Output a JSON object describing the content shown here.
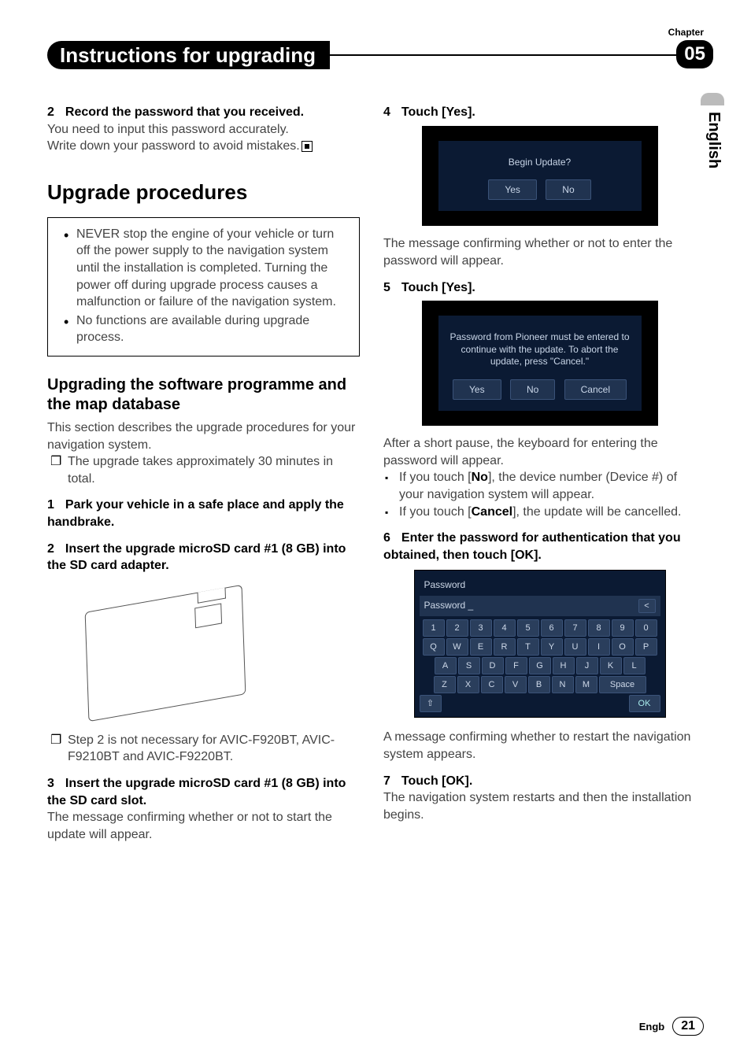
{
  "chapter": {
    "label": "Chapter",
    "number": "05"
  },
  "header": {
    "title": "Instructions for upgrading"
  },
  "side_tab": "English",
  "left": {
    "step2_pre": {
      "num": "2",
      "title": "Record the password that you received."
    },
    "step2_body1": "You need to input this password accurately.",
    "step2_body2": "Write down your password to avoid mistakes.",
    "section": "Upgrade procedures",
    "callout": [
      "NEVER stop the engine of your vehicle or turn off the power supply to the navigation system until the installation is completed. Turning the power off during upgrade process causes a malfunction or failure of the navigation system.",
      "No functions are available during upgrade process."
    ],
    "subheading": "Upgrading the software programme and the map database",
    "sub_body": "This section describes the upgrade procedures for your navigation system.",
    "sub_note": "The upgrade takes approximately 30 minutes in total.",
    "s1": {
      "num": "1",
      "title": "Park your vehicle in a safe place and apply the handbrake."
    },
    "s2": {
      "num": "2",
      "title": "Insert the upgrade microSD card #1 (8 GB) into the SD card adapter."
    },
    "s2_note": "Step 2 is not necessary for AVIC-F920BT, AVIC-F9210BT and AVIC-F9220BT.",
    "s3": {
      "num": "3",
      "title": "Insert the upgrade microSD card #1 (8 GB) into the SD card slot."
    },
    "s3_body": "The message confirming whether or not to start the update will appear."
  },
  "right": {
    "s4": {
      "num": "4",
      "title": "Touch [Yes]."
    },
    "screen1": {
      "msg": "Begin Update?",
      "yes": "Yes",
      "no": "No"
    },
    "s4_body": "The message confirming whether or not to enter the password will appear.",
    "s5": {
      "num": "5",
      "title": "Touch [Yes]."
    },
    "screen2": {
      "msg": "Password from Pioneer must be entered to continue with the update.  To abort the update, press \"Cancel.\"",
      "yes": "Yes",
      "no": "No",
      "cancel": "Cancel"
    },
    "s5_body": "After a short pause, the keyboard for entering the password will appear.",
    "s5_b1a": "If you touch [",
    "s5_b1b": "No",
    "s5_b1c": "], the device number (Device #) of your navigation system will appear.",
    "s5_b2a": "If you touch [",
    "s5_b2b": "Cancel",
    "s5_b2c": "], the update will be cancelled.",
    "s6": {
      "num": "6",
      "title": "Enter the password for authentication that you obtained, then touch [OK]."
    },
    "keyboard": {
      "title": "Password",
      "input_label": "Password",
      "cursor": "_",
      "back": "<",
      "row1": [
        "1",
        "2",
        "3",
        "4",
        "5",
        "6",
        "7",
        "8",
        "9",
        "0"
      ],
      "row2": [
        "Q",
        "W",
        "E",
        "R",
        "T",
        "Y",
        "U",
        "I",
        "O",
        "P"
      ],
      "row3": [
        "A",
        "S",
        "D",
        "F",
        "G",
        "H",
        "J",
        "K",
        "L"
      ],
      "row4": [
        "Z",
        "X",
        "C",
        "V",
        "B",
        "N",
        "M"
      ],
      "space": "Space",
      "shift": "⇧",
      "ok": "OK"
    },
    "s6_body": "A message confirming whether to restart the navigation system appears.",
    "s7": {
      "num": "7",
      "title": "Touch [OK]."
    },
    "s7_body": "The navigation system restarts and then the installation begins."
  },
  "footer": {
    "lang": "Engb",
    "page": "21"
  }
}
